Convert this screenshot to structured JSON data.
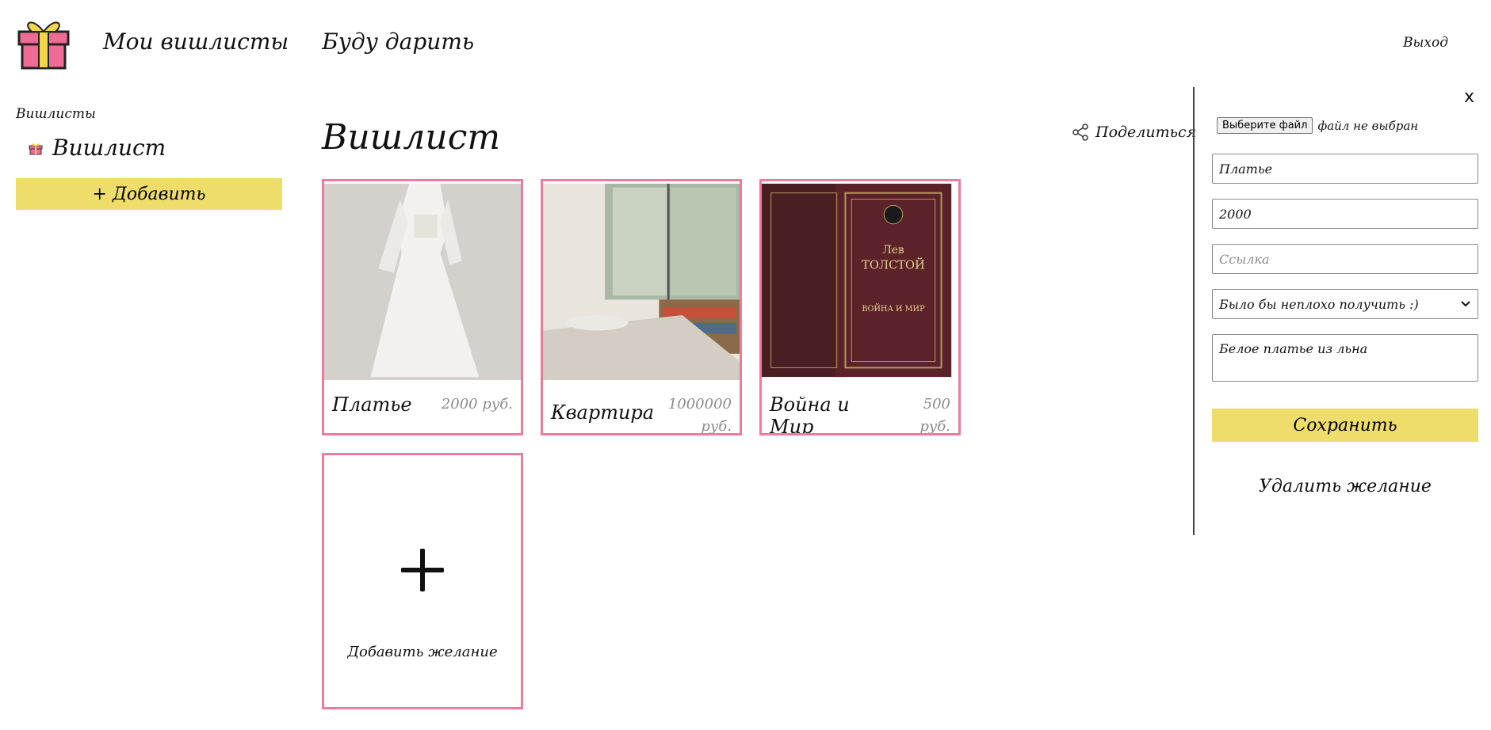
{
  "header": {
    "nav": [
      "Мои вишлисты",
      "Буду дарить"
    ],
    "logout": "Выход",
    "logo_icon": "gift-icon"
  },
  "sidebar": {
    "section_title": "Вишлисты",
    "items": [
      {
        "label": "Вишлист",
        "icon": "gift-icon"
      }
    ],
    "add_label": "+ Добавить"
  },
  "main": {
    "title": "Вишлист",
    "share_label": "Поделиться",
    "cards": [
      {
        "name": "Платье",
        "price": "2000 руб."
      },
      {
        "name": "Квартира",
        "price": "1000000 руб."
      },
      {
        "name": "Война и Мир",
        "price": "500 руб."
      }
    ],
    "add_card_label": "Добавить желание"
  },
  "panel": {
    "close_label": "x",
    "file_button": "Выберите файл",
    "file_status": "файл не выбран",
    "name_value": "Платье",
    "price_value": "2000",
    "link_placeholder": "Ссылка",
    "priority_value": "Было бы неплохо получить :)",
    "description_value": "Белое платье из льна",
    "save_label": "Сохранить",
    "delete_label": "Удалить желание"
  },
  "colors": {
    "accent_yellow": "#eedd6a",
    "card_border_pink": "#ee7b9b",
    "logo_pink": "#f06a96"
  }
}
